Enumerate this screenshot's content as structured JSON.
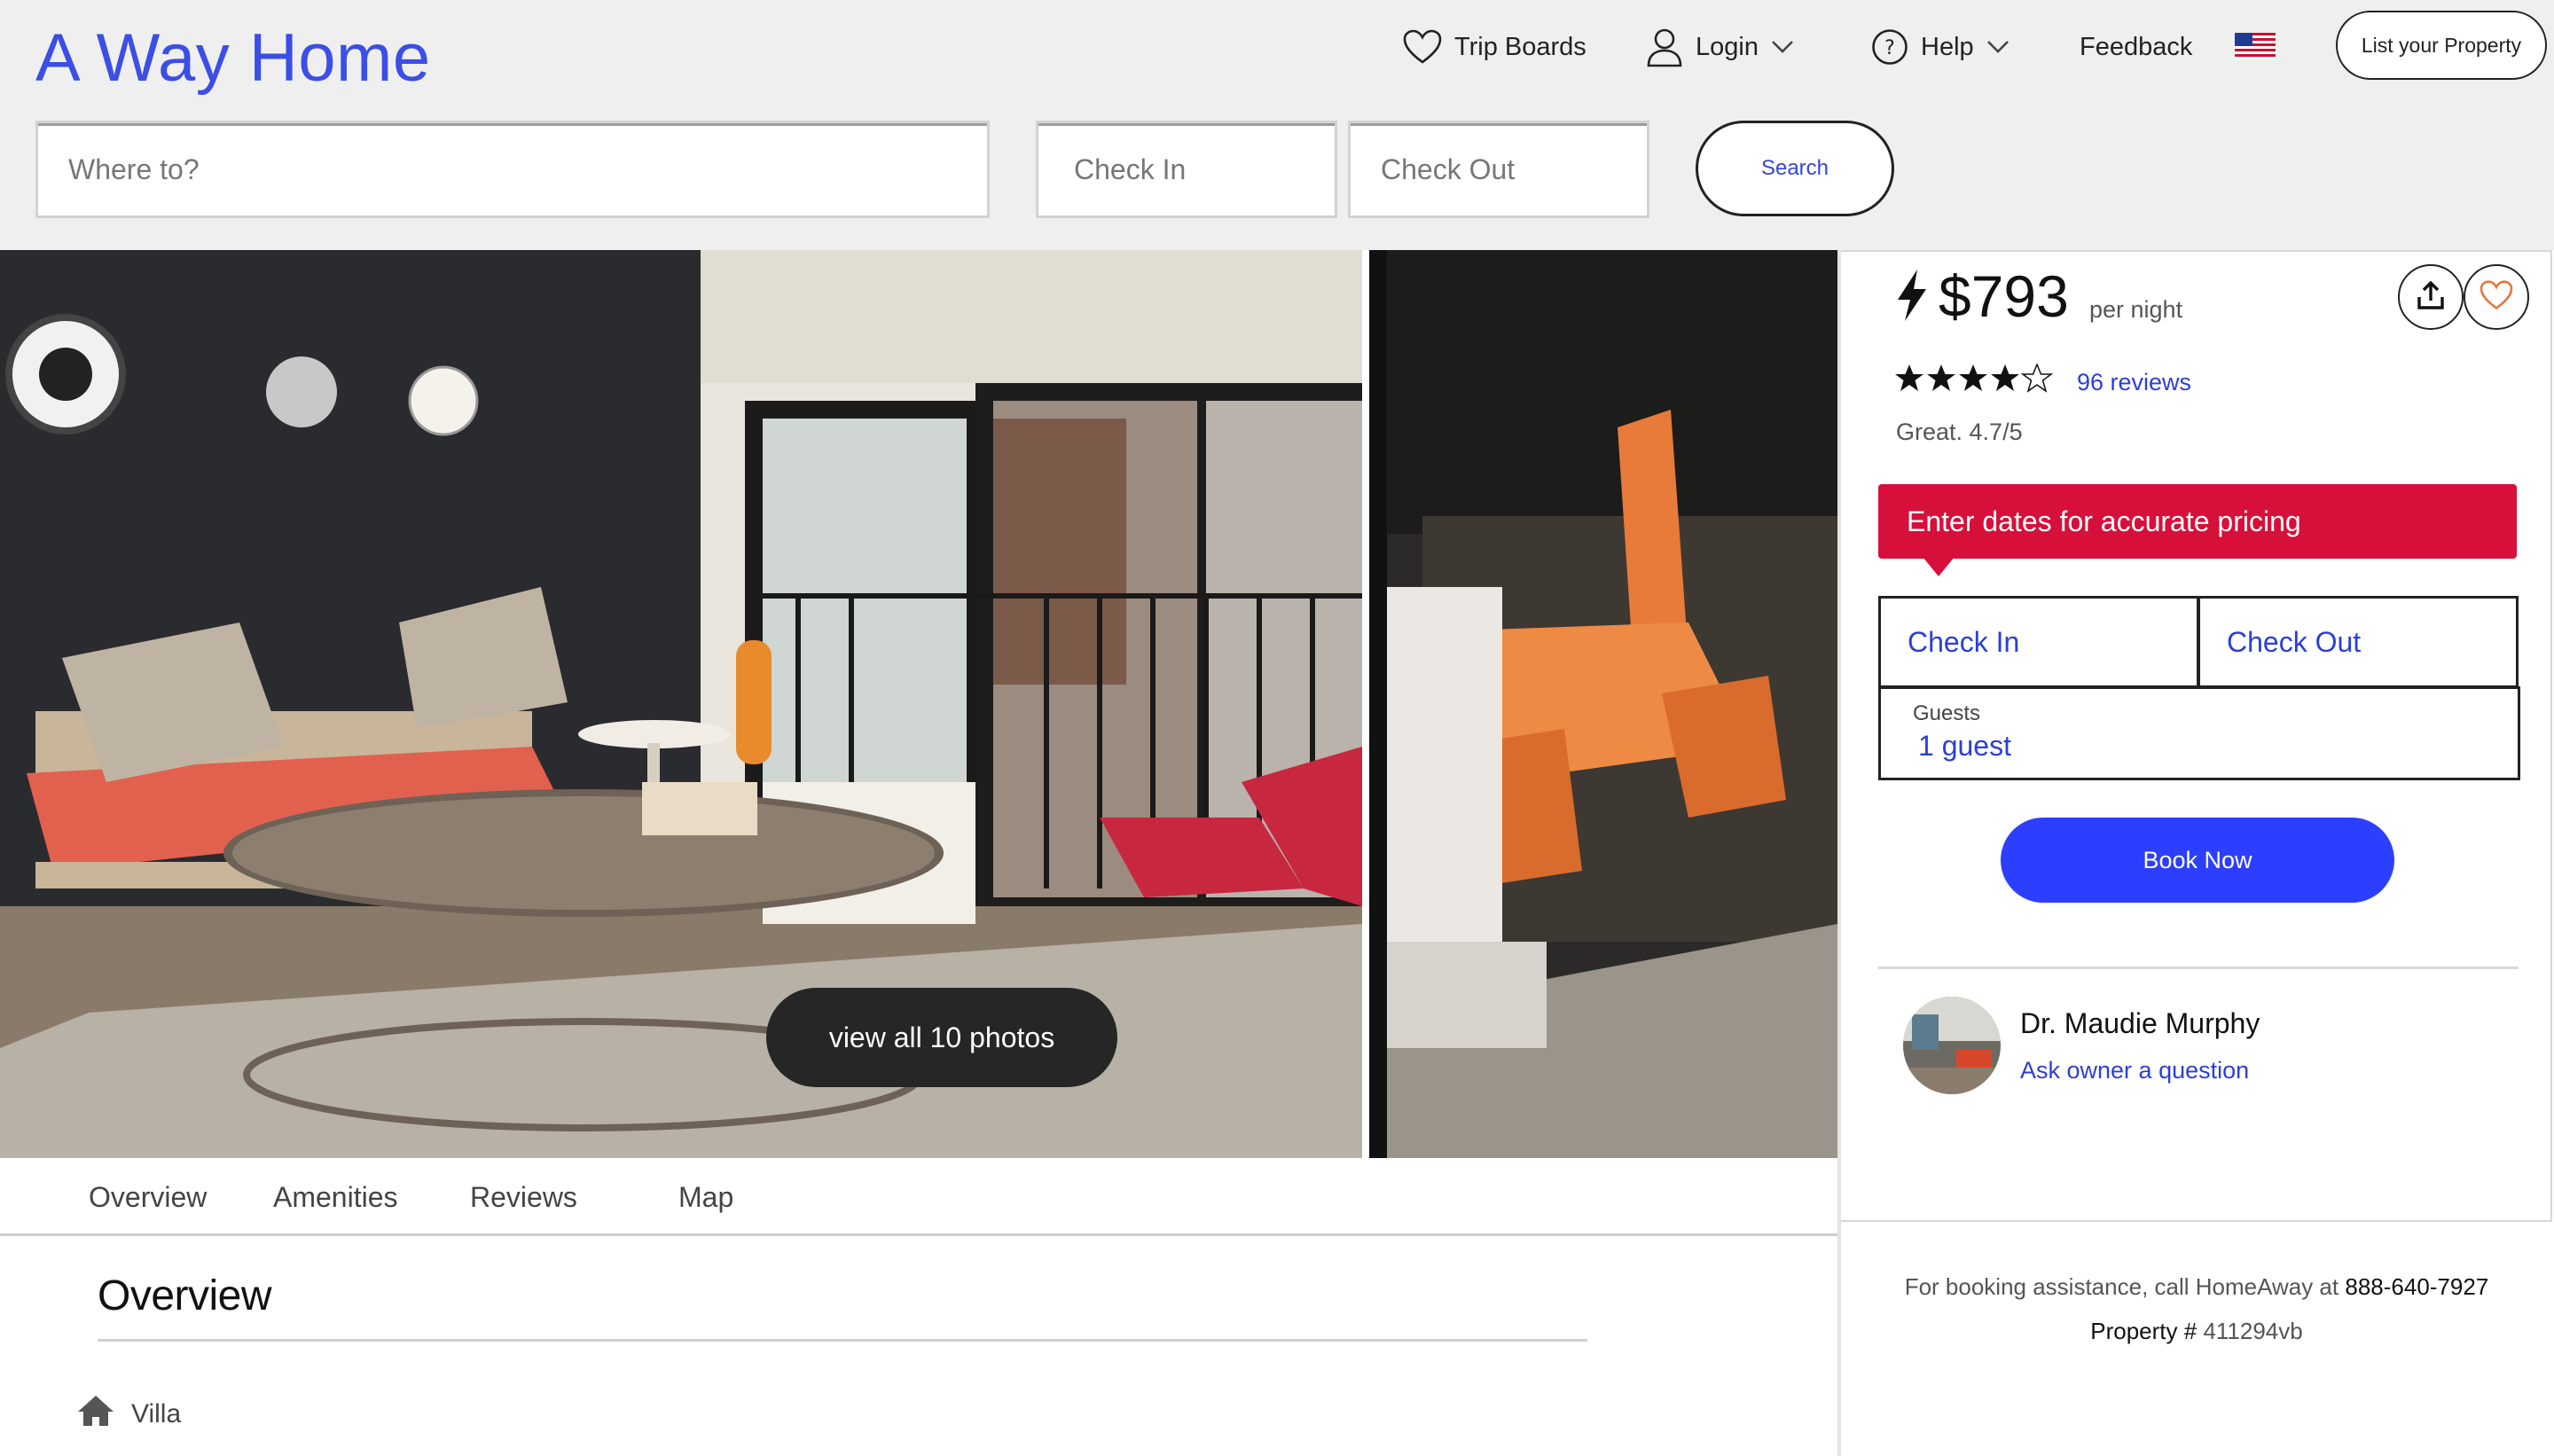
{
  "app": {
    "logo": "A Way Home"
  },
  "nav": {
    "trip_boards": "Trip Boards",
    "login": "Login",
    "help": "Help",
    "feedback": "Feedback",
    "list_property": "List your Property",
    "flag_icon": "us-flag-icon"
  },
  "search": {
    "where_placeholder": "Where to?",
    "checkin_placeholder": "Check In",
    "checkout_placeholder": "Check Out",
    "button": "Search"
  },
  "gallery": {
    "view_all": "view all 10 photos"
  },
  "tabs": [
    "Overview",
    "Amenities",
    "Reviews",
    "Map"
  ],
  "overview": {
    "title": "Overview",
    "property_type": "Villa"
  },
  "booking": {
    "price": "$793",
    "per_night": "per night",
    "stars": 4.5,
    "reviews": "96 reviews",
    "rating": "Great. 4.7/5",
    "alert": "Enter dates for accurate pricing",
    "check_in": "Check In",
    "check_out": "Check Out",
    "guests_label": "Guests",
    "guests_value": "1 guest",
    "book_now": "Book Now",
    "owner_name": "Dr. Maudie Murphy",
    "ask_owner": "Ask owner a question"
  },
  "footer": {
    "assist_text": "For booking assistance, call HomeAway at",
    "phone": "888-640-7927",
    "property_label": "Property #",
    "property_id": "411294vb"
  },
  "colors": {
    "brand_blue": "#3b4ee6",
    "link_blue": "#2b3fd6",
    "alert_red": "#d6103a",
    "button_blue": "#2c3fff"
  }
}
